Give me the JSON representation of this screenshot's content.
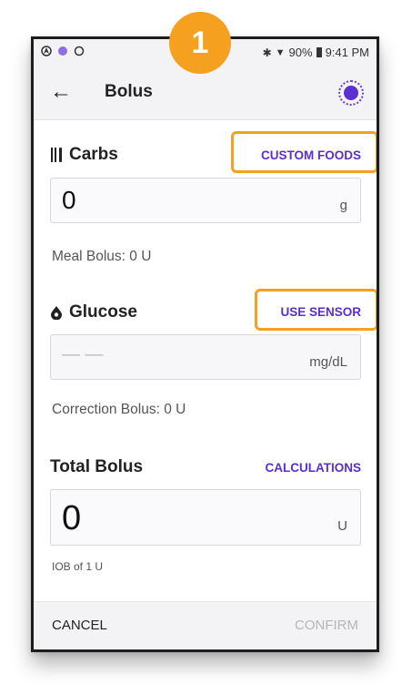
{
  "step_badge": "1",
  "status_bar": {
    "battery": "90%",
    "time": "9:41 PM"
  },
  "app_bar": {
    "title": "Bolus"
  },
  "carbs": {
    "title": "Carbs",
    "action": "CUSTOM FOODS",
    "value": "0",
    "unit": "g",
    "note": "Meal Bolus: 0 U"
  },
  "glucose": {
    "title": "Glucose",
    "action": "USE SENSOR",
    "value": "— —",
    "unit": "mg/dL",
    "note": "Correction Bolus: 0 U"
  },
  "total": {
    "title": "Total Bolus",
    "action": "CALCULATIONS",
    "value": "0",
    "unit": "U",
    "note": "IOB of 1 U"
  },
  "footer": {
    "cancel": "CANCEL",
    "confirm": "CONFIRM"
  },
  "colors": {
    "accent": "#5a2fc9",
    "highlight": "#f5a11f"
  }
}
